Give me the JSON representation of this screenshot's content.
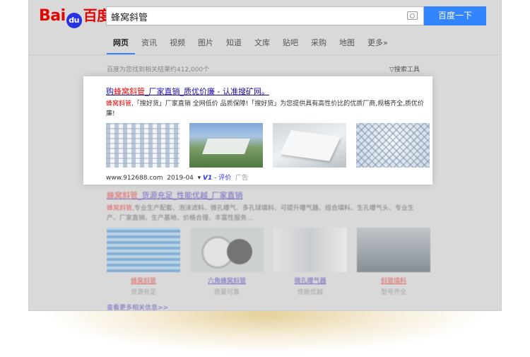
{
  "logo": {
    "text_a": "Bai",
    "text_b": "百度"
  },
  "search": {
    "query": "蜂窝斜管",
    "button": "百度一下"
  },
  "tabs": [
    "网页",
    "资讯",
    "视频",
    "图片",
    "知道",
    "文库",
    "贴吧",
    "采购",
    "地图",
    "更多»"
  ],
  "result_count": "百度为您找到相关结果约412,000个",
  "tools_label": "搜索工具",
  "ad": {
    "title_prefix": "购",
    "title_keyword": "蜂窝斜管",
    "title_rest": "_厂家直销_质优价廉 - 认准搜矿网。",
    "desc_keyword": "蜂窝斜管",
    "desc_rest": ",「搜好货」厂家直销 全网低价 品质保障!「搜好货」为您提供具有高性价比的优质厂商,规格齐全,质优价廉!",
    "url": "www.912688.com",
    "date": "2019-04",
    "v_badge": "V1",
    "review": "评价",
    "ad_label": "广告"
  },
  "second": {
    "title_keyword": "蜂窝斜管",
    "title_rest": "_货源充足_性能优越_厂家直销",
    "desc_keyword": "蜂窝斜管",
    "desc_rest": ",专业生产配套、泡沫滤料、微孔曝气、多孔球填料、可提升曝气器、组合填料、生孔曝气头、专业生产、厂家直销、生产基地、价格合理、丰富性服务...",
    "captions": [
      {
        "name": "蜂窝斜管",
        "sub": "货源充足"
      },
      {
        "name": "六角蜂窝斜管",
        "sub": "质量可靠"
      },
      {
        "name": "微孔曝气器",
        "sub": "性能优越"
      },
      {
        "name": "斜管填料",
        "sub": "型号齐全"
      }
    ],
    "more": "查看更多相关信息>>"
  }
}
